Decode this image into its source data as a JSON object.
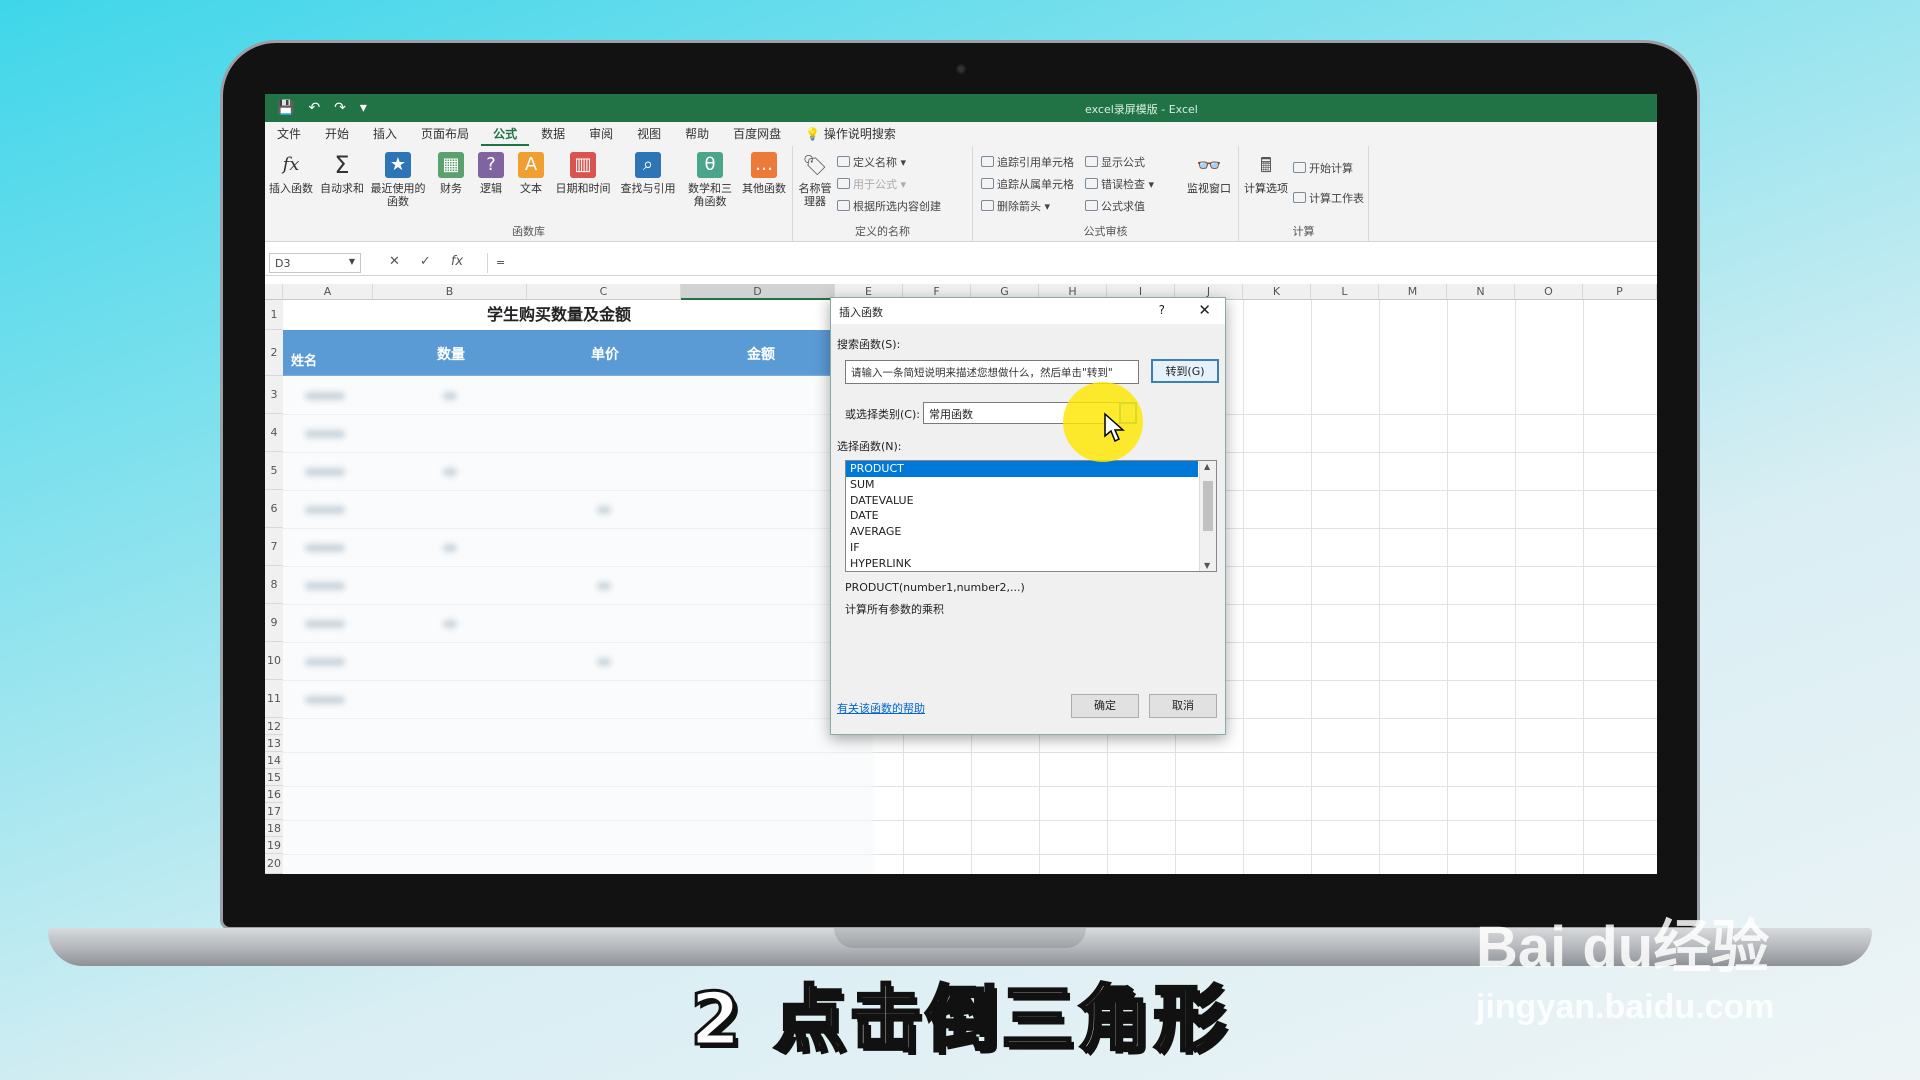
{
  "window": {
    "title": "excel录屏模版 - Excel",
    "qat": [
      "💾",
      "↶",
      "↷",
      "▾"
    ]
  },
  "menu": [
    "文件",
    "开始",
    "插入",
    "页面布局",
    "公式",
    "数据",
    "审阅",
    "视图",
    "帮助",
    "百度网盘",
    "操作说明搜索"
  ],
  "ribbon": {
    "library_buttons": [
      {
        "label": "插入函数",
        "icon": "fx"
      },
      {
        "label": "自动求和",
        "icon": "Σ"
      },
      {
        "label": "最近使用的函数",
        "icon": "★"
      },
      {
        "label": "财务",
        "icon": "▦"
      },
      {
        "label": "逻辑",
        "icon": "?"
      },
      {
        "label": "文本",
        "icon": "A"
      },
      {
        "label": "日期和时间",
        "icon": "▥"
      },
      {
        "label": "查找与引用",
        "icon": "⌕"
      },
      {
        "label": "数学和三角函数",
        "icon": "θ"
      },
      {
        "label": "其他函数",
        "icon": "…"
      }
    ],
    "library_group": "函数库",
    "names_group": "定义的名称",
    "name_manager": "名称管理器",
    "names_rows": [
      "定义名称",
      "用于公式",
      "根据所选内容创建"
    ],
    "audit_group": "公式审核",
    "audit_rows": [
      "追踪引用单元格",
      "追踪从属单元格",
      "删除箭头",
      "显示公式",
      "错误检查",
      "公式求值"
    ],
    "watch_window": "监视窗口",
    "calc_group": "计算",
    "calc_options": "计算选项",
    "calc_rows": [
      "开始计算",
      "计算工作表"
    ]
  },
  "formula_bar": {
    "name_box": "D3",
    "value": "="
  },
  "columns": [
    "A",
    "B",
    "C",
    "D",
    "E",
    "F",
    "G",
    "H",
    "I",
    "J",
    "K",
    "L",
    "M",
    "N",
    "O",
    "P"
  ],
  "rows": [
    "1",
    "2",
    "3",
    "4",
    "5",
    "6",
    "7",
    "8",
    "9",
    "10",
    "11",
    "12",
    "13",
    "14",
    "15",
    "16",
    "17",
    "18",
    "19",
    "20"
  ],
  "sheet": {
    "title": "学生购买数量及金额",
    "headers": {
      "name": "姓名",
      "qty": "数量",
      "price": "单价",
      "amount": "金额"
    }
  },
  "dialog": {
    "title": "插入函数",
    "help": "?",
    "close": "✕",
    "search_label": "搜索函数(S):",
    "search_value": "请输入一条简短说明来描述您想做什么，然后单击\"转到\"",
    "go_button": "转到(G)",
    "category_label": "或选择类别(C):",
    "category_value": "常用函数",
    "select_label": "选择函数(N):",
    "functions": [
      "PRODUCT",
      "SUM",
      "DATEVALUE",
      "DATE",
      "AVERAGE",
      "IF",
      "HYPERLINK"
    ],
    "selected_function": "PRODUCT",
    "signature": "PRODUCT(number1,number2,...)",
    "description": "计算所有参数的乘积",
    "help_link": "有关该函数的帮助",
    "ok_button": "确定",
    "cancel_button": "取消"
  },
  "caption": "2 点击倒三角形",
  "watermark": {
    "brand": "Bai du经验",
    "url": "jingyan.baidu.com"
  },
  "colors": {
    "excel_green": "#217346",
    "header_blue": "#5b9bd5",
    "selection_blue": "#0078d7",
    "highlight_yellow": "#ffe600"
  }
}
